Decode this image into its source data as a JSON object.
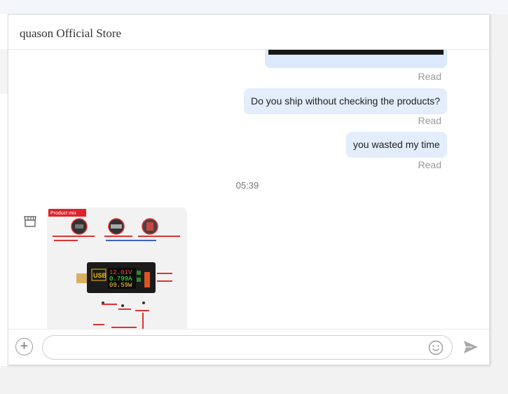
{
  "chat": {
    "store_name": "quason Official Store",
    "messages": [
      {
        "status": "Read"
      },
      {
        "text": "Do you ship without checking the products?",
        "status": "Read"
      },
      {
        "text": "you wasted my time",
        "status": "Read"
      }
    ],
    "time_divider": "05:39",
    "product_image": {
      "badge": "Product mix",
      "screen_lines": [
        "12.01V",
        "0.799A",
        "09.59W"
      ],
      "usb_label": "USB"
    }
  },
  "composer": {
    "placeholder": "",
    "icons": {
      "add": "plus-circle-icon",
      "emoji": "smiley-icon",
      "send": "send-arrow-icon"
    }
  },
  "colors": {
    "bubble": "#e3edfb",
    "read_text": "#9a9a9a",
    "badge": "#e0202a"
  }
}
